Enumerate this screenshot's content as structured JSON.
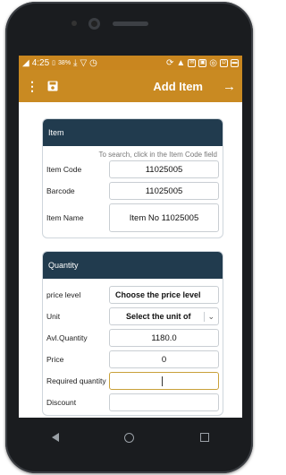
{
  "statusbar": {
    "time": "4:25",
    "battery": "38%"
  },
  "appbar": {
    "title": "Add Item",
    "menu_icon": "more-vert-icon",
    "save_icon": "save-icon",
    "next_icon": "arrow-right-icon"
  },
  "item_section": {
    "header": "Item",
    "hint": "To search, click in the Item Code field",
    "item_code_label": "Item Code",
    "item_code_value": "11025005",
    "barcode_label": "Barcode",
    "barcode_value": "11025005",
    "item_name_label": "Item Name",
    "item_name_value": "Item No 11025005"
  },
  "quantity_section": {
    "header": "Quantity",
    "price_level_label": "price level",
    "price_level_value": "Choose the price level",
    "unit_label": "Unit",
    "unit_value": "Select the unit of",
    "avl_quantity_label": "Avl.Quantity",
    "avl_quantity_value": "1180.0",
    "price_label": "Price",
    "price_value": "0",
    "required_quantity_label": "Required quantity",
    "required_quantity_value": "",
    "discount_label": "Discount"
  },
  "colors": {
    "accent": "#c98a22",
    "card_header": "#213b4e"
  }
}
